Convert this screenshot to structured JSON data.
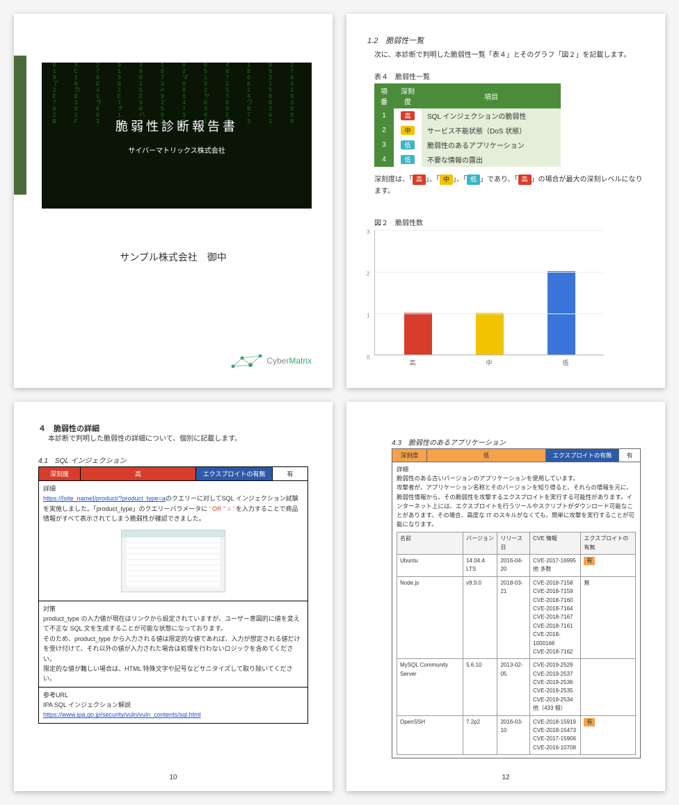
{
  "page1": {
    "title": "脆弱性診断報告書",
    "subtitle": "サイバーマトリックス株式会社",
    "client": "サンプル株式会社　御中",
    "logo_a": "Cyber",
    "logo_b": "Matrix"
  },
  "page2": {
    "section": "1.2　脆弱性一覧",
    "intro": "次に、本診断で判明した脆弱性一覧「表４」とそのグラフ「図２」を記載します。",
    "table_caption": "表４　脆弱性一覧",
    "th_no": "項番",
    "th_sev": "深刻度",
    "th_item": "項目",
    "rows": [
      {
        "no": "1",
        "sev": "高",
        "sev_cls": "sev-high",
        "item": "SQL インジェクションの脆弱性"
      },
      {
        "no": "2",
        "sev": "中",
        "sev_cls": "sev-med",
        "item": "サービス不能状態（DoS 状態）"
      },
      {
        "no": "3",
        "sev": "低",
        "sev_cls": "sev-low",
        "item": "脆弱性のあるアプリケーション"
      },
      {
        "no": "4",
        "sev": "低",
        "sev_cls": "sev-low",
        "item": "不要な情報の露出"
      }
    ],
    "legend_a": "深刻度は、「",
    "legend_b": "」、「",
    "legend_c": "」、「",
    "legend_d": "」であり、「",
    "legend_e": "」の場合が最大の深刻レベルになります。",
    "fig_caption": "図２　脆弱性数"
  },
  "chart_data": {
    "type": "bar",
    "title": "脆弱性数",
    "categories": [
      "高",
      "中",
      "低"
    ],
    "values": [
      1,
      1,
      2
    ],
    "colors": [
      "#d83c2b",
      "#f2c300",
      "#3a74d8"
    ],
    "ylim": [
      0,
      3
    ],
    "yticks": [
      0,
      1,
      2,
      3
    ],
    "xlabel": "",
    "ylabel": ""
  },
  "page3": {
    "heading": "４　脆弱性の詳細",
    "intro": "本診断で判明した脆弱性の詳細について、個別に記載します。",
    "sub": "4.1　SQL インジェクション",
    "hdr_sev_label": "深刻度",
    "hdr_sev_value": "高",
    "hdr_exp_label": "エクスプロイトの有無",
    "hdr_exp_value": "有",
    "detail_h": "詳細",
    "detail_link": "https://[site_name]/product/?product_type=a",
    "detail_1a": "のクエリーに対してSQL インジェクション試験を実施しました。「product_type」のクエリーパラメータに ",
    "detail_code": "' OR '' = '",
    "detail_1b": " を入力することで商品情報がすべて表示されてしまう脆弱性が確認できました。",
    "counter_h": "対策",
    "counter_1": "product_type の入力値が現在はリンクから設定されていますが、ユーザー意図的に値を変えて不正な SQL 文を生成することが可能な状態になっております。",
    "counter_2": "そのため、product_type から入力される値は限定的な値であれば、入力が想定される値だけを受け付けて、それ以外の値が入力された場合は処理を行わないロジックを含めてください。",
    "counter_3": "限定的な値が難しい場合は、HTML 特殊文字や記号などサニタイズして取り除いてください。",
    "ref_h": "参考URL",
    "ref_1": "IPA SQL インジェクション解説",
    "ref_link": "https://www.ipa.go.jp/security/vuln/vuln_contents/sql.html",
    "page_num": "10"
  },
  "page4": {
    "sub": "4.3　脆弱性のあるアプリケーション",
    "hdr_sev_label": "深刻度",
    "hdr_sev_value": "低",
    "hdr_exp_label": "エクスプロイトの有無",
    "hdr_exp_value": "有",
    "desc_h": "詳細",
    "desc_1": "脆弱性のある古いバージョンのアプリケーションを使用しています。",
    "desc_2": "攻撃者が、アプリケーション名称とそのバージョンを知り得ると、それらの情報を元に、脆弱性情報から、その脆弱性を攻撃するエクスプロイトを実行する可能性があります。インターネット上には、エクスプロイトを行うツールやスクリプトがダウンロード可能なことがあります。その場合、高度な IT のスキルがなくても、簡単に攻撃を実行することが可能になります。",
    "th_name": "名前",
    "th_ver": "バージョン",
    "th_rel": "リリース日",
    "th_cve": "CVE 情報",
    "th_exp": "エクスプロイトの有無",
    "rows": [
      {
        "name": "Ubuntu",
        "ver": "14.04.4 LTS",
        "rel": "2016-04-20",
        "cve": [
          "CVE-2017-16995",
          "他 多数"
        ],
        "exp": "有",
        "exp_flag": true
      },
      {
        "name": "Node.js",
        "ver": "v9.9.0",
        "rel": "2018-03-21",
        "cve": [
          "CVE-2018-7158",
          "CVE-2018-7159",
          "CVE-2018-7160",
          "CVE-2018-7164",
          "CVE-2018-7167",
          "CVE-2018-7161",
          "CVE-2018-1000168",
          "CVE-2018-7162"
        ],
        "exp": "無",
        "exp_flag": false
      },
      {
        "name": "MySQL Community Server",
        "ver": "5.6.10",
        "rel": "2013-02-05",
        "cve": [
          "CVE-2019-2529",
          "CVE-2019-2537",
          "CVE-2019-2536",
          "CVE-2019-2535",
          "CVE-2019-2534",
          "他（433 個）"
        ],
        "exp": "",
        "exp_flag": false
      },
      {
        "name": "OpenSSH",
        "ver": "7.2p2",
        "rel": "2016-03-10",
        "cve": [
          "CVE-2018-15919",
          "CVE-2018-15473",
          "CVE-2017-15906",
          "CVE-2016-10708"
        ],
        "exp": "有",
        "exp_flag": true
      }
    ],
    "page_num": "12"
  }
}
